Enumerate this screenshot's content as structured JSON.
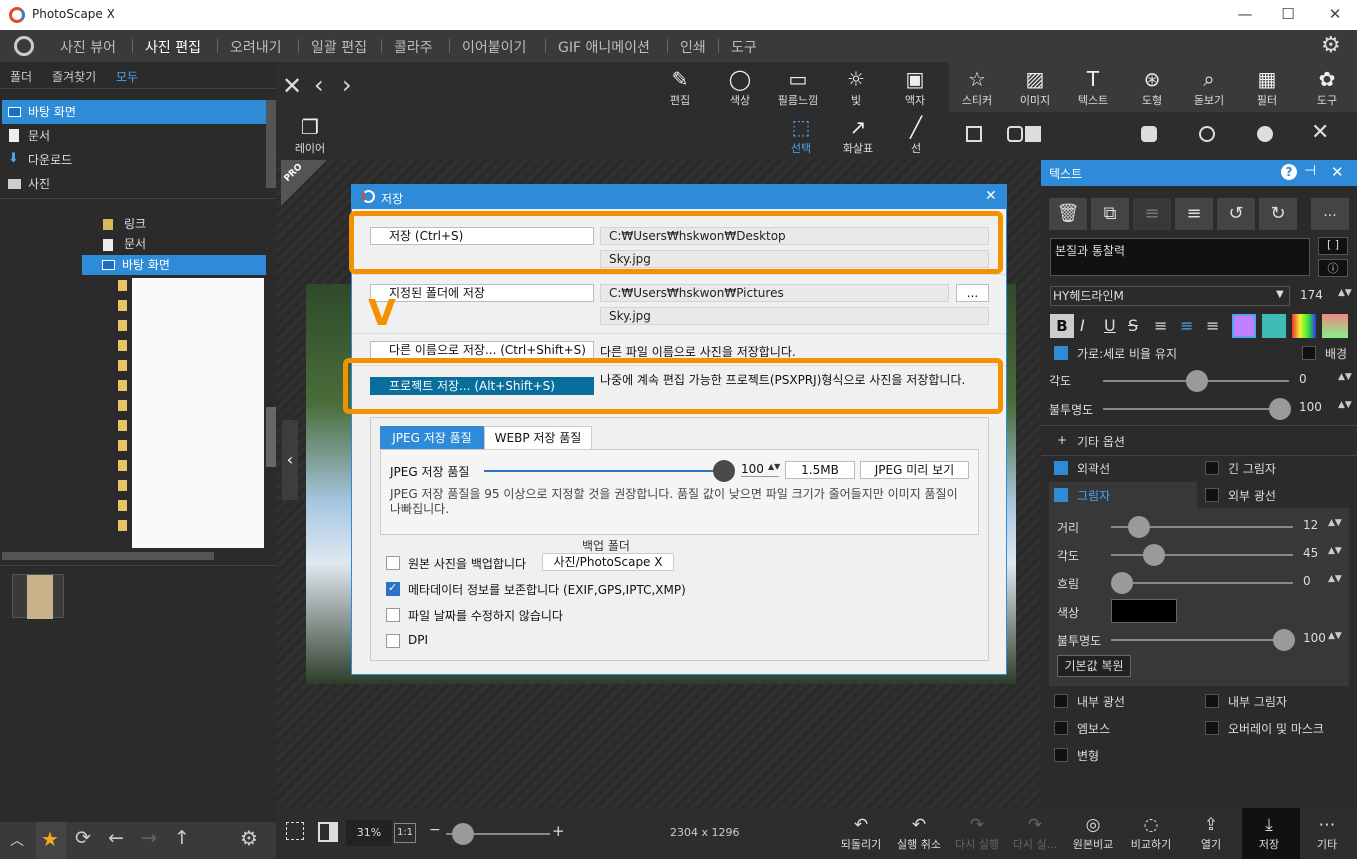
{
  "app": {
    "title": "PhotoScape X"
  },
  "menu": {
    "items": [
      "사진 뷰어",
      "사진 편집",
      "오려내기",
      "일괄 편집",
      "콜라주",
      "이어붙이기",
      "GIF 애니메이션",
      "인쇄",
      "도구"
    ],
    "active_index": 1
  },
  "left": {
    "tabs": [
      "폴더",
      "즐겨찾기",
      "모두"
    ],
    "quick": [
      "바탕 화면",
      "문서",
      "다운로드",
      "사진"
    ],
    "tree": [
      "링크",
      "문서",
      "바탕 화면"
    ]
  },
  "toolbar": {
    "main": [
      "편집",
      "색상",
      "필름느낌",
      "빛",
      "액자",
      "스티커",
      "이미지",
      "텍스트",
      "도형",
      "돋보기",
      "필터",
      "도구"
    ],
    "second": [
      "레이어",
      "선택",
      "화살표",
      "선"
    ]
  },
  "dialog": {
    "title": "저장",
    "save_label": "저장    (Ctrl+S)",
    "save_path": "C:₩Users₩hskwon₩Desktop",
    "save_file": "Sky.jpg",
    "folder_label": "지정된 폴더에 저장",
    "folder_path": "C:₩Users₩hskwon₩Pictures",
    "folder_file": "Sky.jpg",
    "browse": "...",
    "saveas_label": "다른 이름으로 저장...     (Ctrl+Shift+S)",
    "saveas_desc": "다른 파일 이름으로 사진을 저장합니다.",
    "project_label": "프로젝트 저장...     (Alt+Shift+S)",
    "project_desc": "나중에 계속 편집 가능한 프로젝트(PSXPRJ)형식으로 사진을 저장합니다.",
    "tab_jpeg": "JPEG 저장 품질",
    "tab_webp": "WEBP 저장 품질",
    "quality_label": "JPEG 저장 품질",
    "quality_value": "100",
    "quality_level": 1.0,
    "size": "1.5MB",
    "preview": "JPEG 미리 보기",
    "quality_note": "JPEG 저장 품질을 95 이상으로 지정할 것을 권장합니다. 품질 값이 낮으면 파일 크기가 줄어들지만 이미지 품질이 나빠집니다.",
    "backup_title": "백업 폴더",
    "backup_label": "원본 사진을 백업합니다",
    "backup_folder": "사진/PhotoScape X",
    "meta_label": "메타데이터 정보를 보존합니다 (EXIF,GPS,IPTC,XMP)",
    "date_label": "파일 날짜를 수정하지 않습니다",
    "dpi_label": "DPI"
  },
  "annot": {
    "arrow": "V"
  },
  "right": {
    "title": "텍스트",
    "text_value": "본질과 통찰력",
    "font": "HY헤드라인M",
    "font_size": "174",
    "ratio": "가로:세로 비율 유지",
    "bg": "배경",
    "angle": "각도",
    "angle_val": "0",
    "opacity": "불투명도",
    "opacity_val": "100",
    "more": "기타 옵션",
    "outline": "외곽선",
    "long_shadow": "긴 그림자",
    "shadow": "그림자",
    "outer_glow": "외부 광선",
    "dist": "거리",
    "dist_val": "12",
    "angle2": "각도",
    "angle2_val": "45",
    "blur": "흐림",
    "blur_val": "0",
    "color": "색상",
    "opacity2": "불투명도",
    "opacity2_val": "100",
    "reset": "기본값 복원",
    "inner_glow": "내부 광선",
    "inner_shadow": "내부 그림자",
    "emboss": "엠보스",
    "overlay": "오버레이 및 마스크",
    "transform": "변형"
  },
  "bottom": {
    "zoom": "31%",
    "zoom_one": "1:1",
    "dimensions": "2304 x 1296",
    "buttons": [
      "되돌리기",
      "실행 취소",
      "다시 실행",
      "다시 실...",
      "원본비교",
      "비교하기",
      "열기",
      "저장",
      "기타"
    ]
  },
  "colors": {
    "accent": "#2d8bd8",
    "highlight": "#f39200"
  }
}
